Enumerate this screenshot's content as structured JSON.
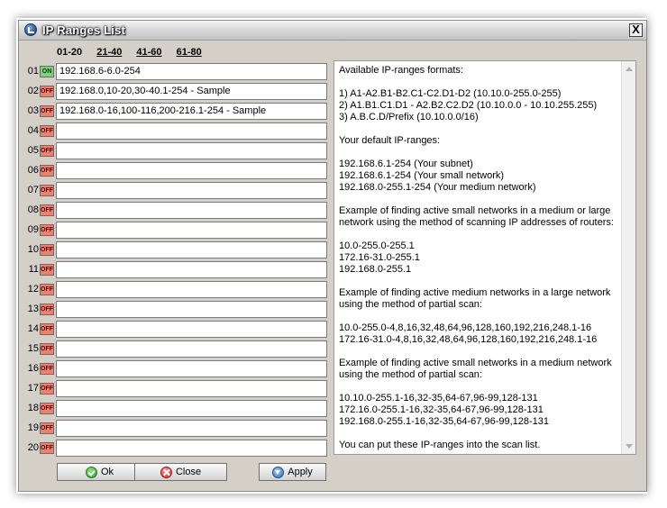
{
  "window": {
    "title": "IP Ranges List",
    "close_label": "X"
  },
  "page_tabs": [
    {
      "label": "01-20",
      "active": true
    },
    {
      "label": "21-40",
      "active": false
    },
    {
      "label": "41-60",
      "active": false
    },
    {
      "label": "61-80",
      "active": false
    }
  ],
  "rows": [
    {
      "num": "01",
      "state": "ON",
      "value": "192.168.6-6.0-254"
    },
    {
      "num": "02",
      "state": "OFF",
      "value": "192.168.0,10-20,30-40.1-254 - Sample"
    },
    {
      "num": "03",
      "state": "OFF",
      "value": "192.168.0-16,100-116,200-216.1-254 - Sample"
    },
    {
      "num": "04",
      "state": "OFF",
      "value": ""
    },
    {
      "num": "05",
      "state": "OFF",
      "value": ""
    },
    {
      "num": "06",
      "state": "OFF",
      "value": ""
    },
    {
      "num": "07",
      "state": "OFF",
      "value": ""
    },
    {
      "num": "08",
      "state": "OFF",
      "value": ""
    },
    {
      "num": "09",
      "state": "OFF",
      "value": ""
    },
    {
      "num": "10",
      "state": "OFF",
      "value": ""
    },
    {
      "num": "11",
      "state": "OFF",
      "value": ""
    },
    {
      "num": "12",
      "state": "OFF",
      "value": ""
    },
    {
      "num": "13",
      "state": "OFF",
      "value": ""
    },
    {
      "num": "14",
      "state": "OFF",
      "value": ""
    },
    {
      "num": "15",
      "state": "OFF",
      "value": ""
    },
    {
      "num": "16",
      "state": "OFF",
      "value": ""
    },
    {
      "num": "17",
      "state": "OFF",
      "value": ""
    },
    {
      "num": "18",
      "state": "OFF",
      "value": ""
    },
    {
      "num": "19",
      "state": "OFF",
      "value": ""
    },
    {
      "num": "20",
      "state": "OFF",
      "value": ""
    }
  ],
  "info_paragraphs": [
    "Available IP-ranges formats:",
    "1) A1-A2.B1-B2.C1-C2.D1-D2 (10.10.0-255.0-255)\n2) A1.B1.C1.D1 - A2.B2.C2.D2 (10.10.0.0 - 10.10.255.255)\n3) A.B.C.D/Prefix (10.10.0.0/16)",
    "Your default IP-ranges:",
    "192.168.6.1-254  (Your subnet)\n192.168.6.1-254  (Your small network)\n192.168.0-255.1-254  (Your medium network)",
    "Example of finding active small networks in a medium or large network using the method of scanning IP addresses of routers:",
    "10.0-255.0-255.1\n172.16-31.0-255.1\n192.168.0-255.1",
    "Example of finding active medium networks in a large network using the method of partial scan:",
    "10.0-255.0-4,8,16,32,48,64,96,128,160,192,216,248.1-16\n172.16-31.0-4,8,16,32,48,64,96,128,160,192,216,248.1-16",
    "Example of finding active small networks in a medium network using the method of partial scan:",
    "10.10.0-255.1-16,32-35,64-67,96-99,128-131\n172.16.0-255.1-16,32-35,64-67,96-99,128-131\n192.168.0-255.1-16,32-35,64-67,96-99,128-131",
    "You can put these IP-ranges into the scan list."
  ],
  "buttons": {
    "ok": "Ok",
    "close": "Close",
    "apply": "Apply"
  },
  "colors": {
    "on": "#7ed07a",
    "off": "#e8836f",
    "window_bg": "#d4d0c8"
  }
}
